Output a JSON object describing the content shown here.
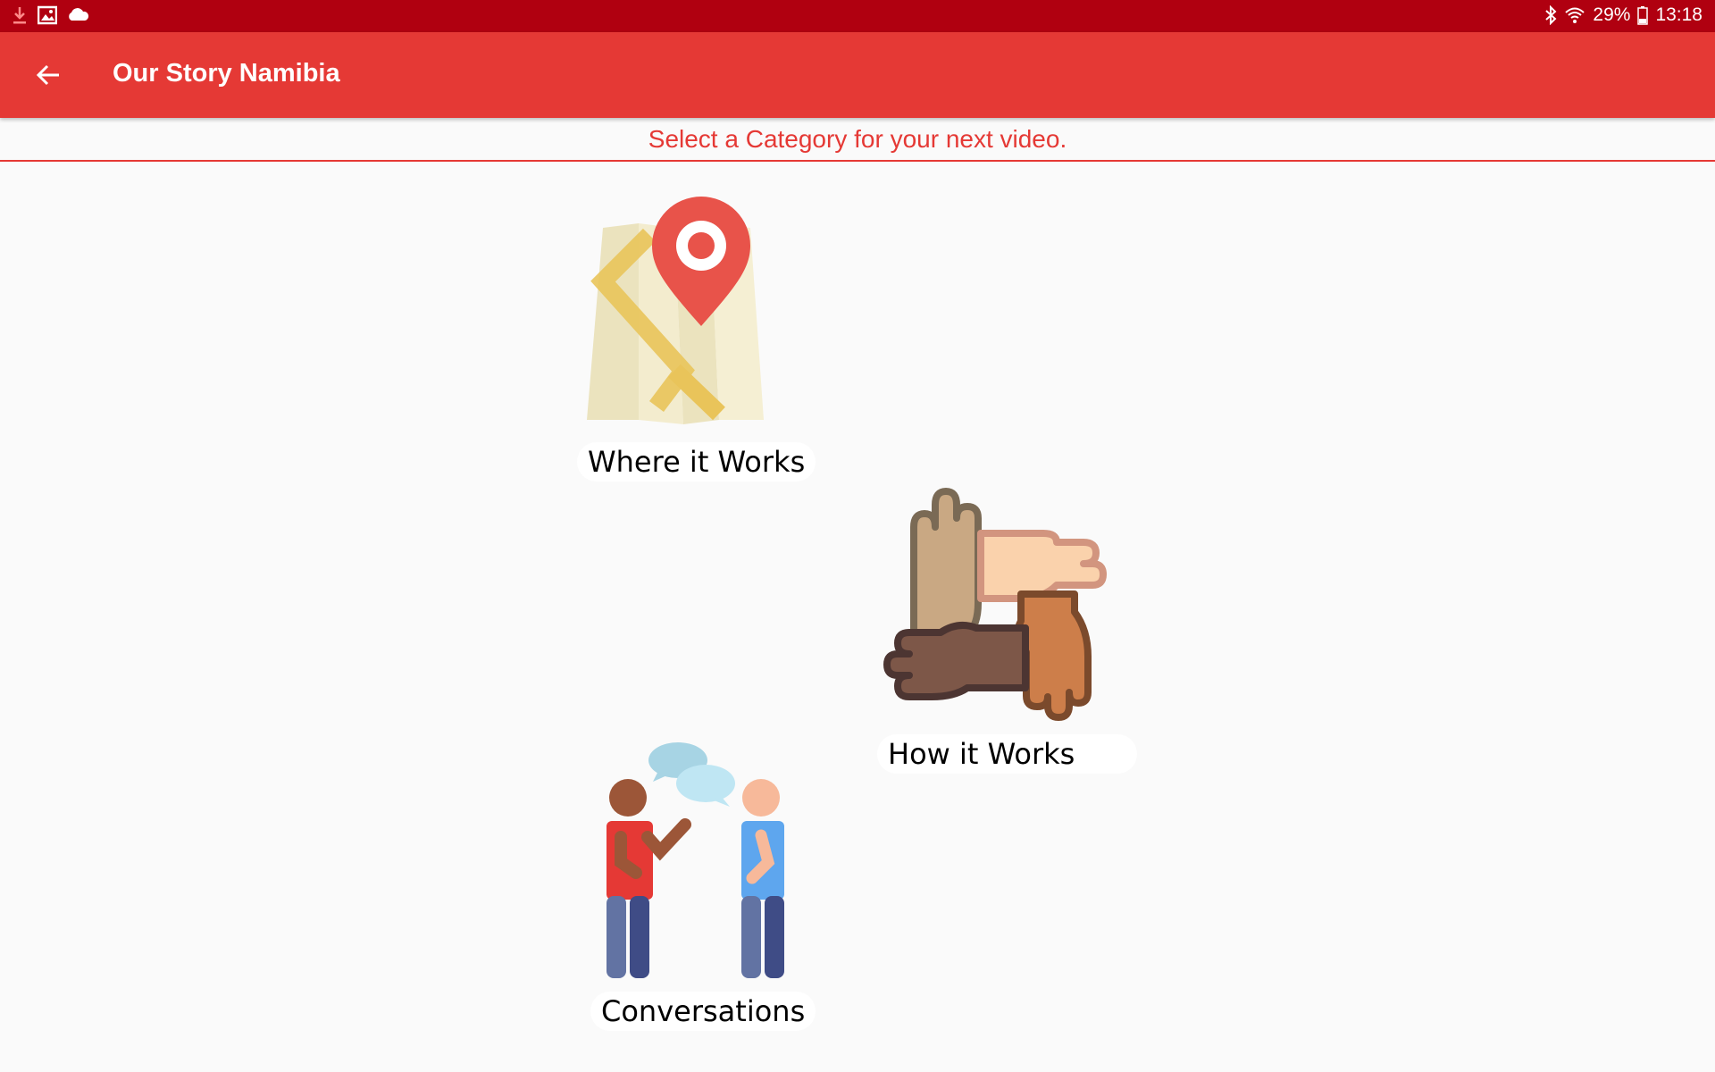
{
  "status_bar": {
    "icons_left": [
      "download-icon",
      "image-icon",
      "cloud-icon"
    ],
    "bluetooth": "bluetooth-icon",
    "wifi": "wifi-icon",
    "battery_percent": "29%",
    "time": "13:18"
  },
  "app_bar": {
    "back_icon": "arrow-back-icon",
    "title": "Our Story Namibia"
  },
  "header": {
    "instruction": "Select a Category for your next video."
  },
  "categories": [
    {
      "label": "Where it Works",
      "icon": "map-pin-icon"
    },
    {
      "label": "How it Works",
      "icon": "hands-icon"
    },
    {
      "label": "Conversations",
      "icon": "conversation-icon"
    }
  ],
  "colors": {
    "status_bar": "#b00010",
    "app_bar": "#e53935",
    "accent": "#e53935",
    "background": "#fafafa"
  }
}
